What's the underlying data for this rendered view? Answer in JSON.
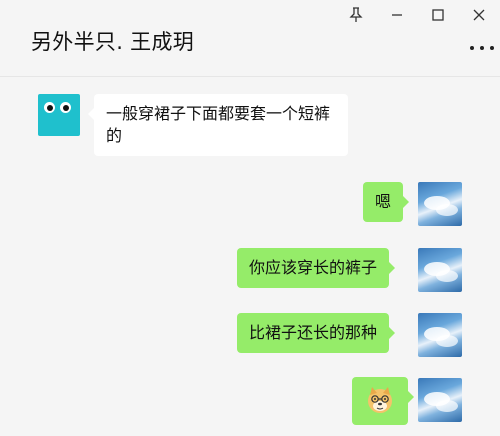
{
  "window": {
    "title": "另外半只. 王成玥"
  },
  "header_icons": [
    "pin-icon",
    "minimize-icon",
    "maximize-icon",
    "close-icon",
    "more-icon"
  ],
  "messages": [
    {
      "side": "left",
      "text": "一般穿裙子下面都要套一个短裤的"
    },
    {
      "side": "right",
      "text": "嗯"
    },
    {
      "side": "right",
      "text": "你应该穿长的裤子"
    },
    {
      "side": "right",
      "text": "比裙子还长的那种"
    },
    {
      "side": "right",
      "type": "emoji",
      "emoji": "doge-emoji"
    }
  ],
  "colors": {
    "outgoing_bubble": "#95ec69",
    "incoming_bubble": "#ffffff",
    "background": "#f5f5f5",
    "left_avatar": "#1fc0cd"
  }
}
